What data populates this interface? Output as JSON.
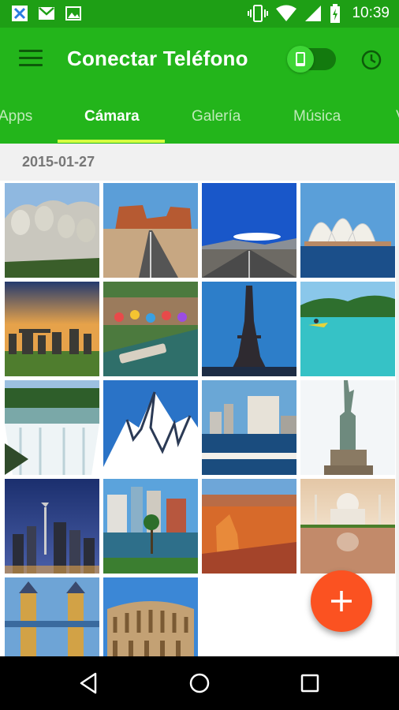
{
  "status_bar": {
    "time": "10:39",
    "left_icons": [
      "app-x-icon",
      "gmail-icon",
      "image-notification-icon"
    ],
    "right_icons": [
      "vibrate-icon",
      "wifi-icon",
      "cellular-icon",
      "battery-icon"
    ]
  },
  "app_bar": {
    "title": "Conectar Teléfono",
    "toggle_state": "on"
  },
  "tabs": [
    {
      "label": "Apps"
    },
    {
      "label": "Cámara"
    },
    {
      "label": "Galería"
    },
    {
      "label": "Música"
    },
    {
      "label": "V"
    }
  ],
  "active_tab": "Cámara",
  "gallery": {
    "date": "2015-01-27",
    "photos": [
      "mount-rushmore",
      "desert-road-monument-valley",
      "mountain-road",
      "sydney-opera-house",
      "stonehenge",
      "san-antonio-river-walk",
      "eiffel-tower",
      "tropical-lagoon-kayak",
      "niagara-falls",
      "snowy-mountain",
      "city-waterfront",
      "statue-of-liberty",
      "seattle-space-needle",
      "city-park-lake",
      "red-rock-canyon",
      "taj-mahal",
      "tower-bridge",
      "colosseum"
    ]
  },
  "fab": {
    "icon": "plus-icon"
  },
  "nav": {
    "buttons": [
      "back-icon",
      "home-icon",
      "recents-icon"
    ]
  },
  "colors": {
    "primary": "#23b51b",
    "status": "#1e9f15",
    "accent": "#fb5221",
    "indicator": "#d6ff40"
  }
}
